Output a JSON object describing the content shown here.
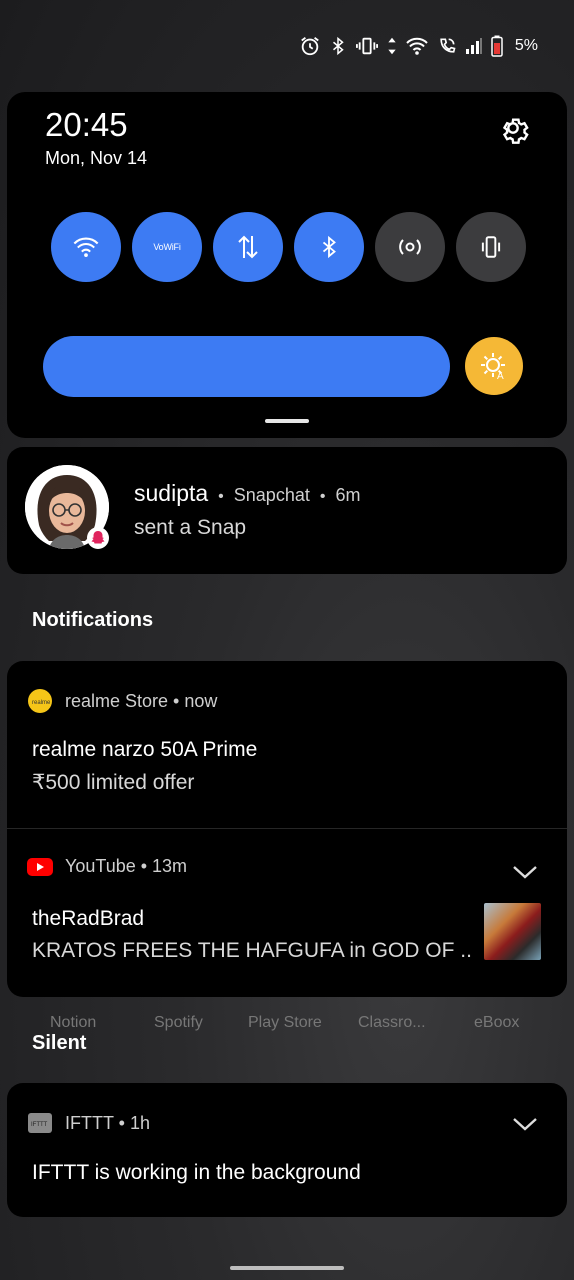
{
  "status_bar": {
    "icons": [
      "alarm-icon",
      "bluetooth-icon",
      "vibrate-icon",
      "data-arrows-icon",
      "wifi-icon",
      "wifi-calling-icon",
      "signal-icon",
      "battery-low-icon"
    ],
    "battery_percent": "5%",
    "battery_color": "#e53935"
  },
  "quick_settings": {
    "time": "20:45",
    "date": "Mon, Nov 14",
    "tiles": [
      {
        "name": "wifi",
        "icon": "wifi-icon",
        "active": true
      },
      {
        "name": "vowifi",
        "label": "VoWiFi",
        "active": true
      },
      {
        "name": "mobile-data",
        "icon": "data-arrows-icon",
        "active": true
      },
      {
        "name": "bluetooth",
        "icon": "bluetooth-icon",
        "active": true
      },
      {
        "name": "hotspot",
        "icon": "hotspot-icon",
        "active": false
      },
      {
        "name": "vibrate",
        "icon": "vibrate-icon",
        "active": false
      }
    ],
    "brightness_level": 1.0,
    "accent_color": "#3d7bf3",
    "auto_brightness_color": "#f5b836"
  },
  "snap_notification": {
    "sender": "sudipta",
    "app": "Snapchat",
    "time": "6m",
    "message": "sent a Snap"
  },
  "sections": {
    "notifications_label": "Notifications",
    "silent_label": "Silent"
  },
  "notifications": [
    {
      "app": "realme Store",
      "time": "now",
      "header": "realme Store • now",
      "title": "realme narzo 50A Prime",
      "text": "₹500 limited offer"
    },
    {
      "app": "YouTube",
      "time": "13m",
      "header": "YouTube • 13m",
      "title": "theRadBrad",
      "text": "KRATOS FREES THE HAFGUFA in GOD OF .."
    }
  ],
  "dock_labels": [
    "Notion",
    "Spotify",
    "Play Store",
    "Classro...",
    "eBoox"
  ],
  "silent_notifications": [
    {
      "app": "IFTTT",
      "time": "1h",
      "header": "IFTTT • 1h",
      "title": "IFTTT is working in the background"
    }
  ]
}
